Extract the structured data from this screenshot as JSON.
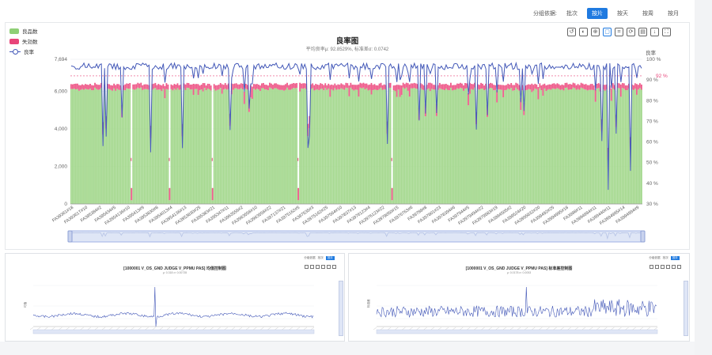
{
  "group_bar": {
    "label": "分组依据:",
    "options": [
      "批次",
      "按片",
      "按天",
      "按周",
      "按月"
    ],
    "active_index": 1
  },
  "main_chart": {
    "title": "良率图",
    "subtitle": "平均良率μ: 92.8529%, 标准差σ: 0.0742",
    "legend": [
      {
        "name": "良品数",
        "color": "#8fcf76"
      },
      {
        "name": "失効数",
        "color": "#e8457a"
      },
      {
        "name": "良率",
        "color": "#4358b8"
      }
    ],
    "right_axis_name": "良率",
    "avg_label": "92 %",
    "toolbox_icons": [
      "restore-icon",
      "palette-icon",
      "zoom-icon",
      "select-rect-icon",
      "select-lasso-icon",
      "refresh-icon",
      "data-view-icon",
      "download-icon",
      "fullscreen-icon"
    ]
  },
  "chart_data": [
    {
      "type": "bar",
      "title": "良率图",
      "subtitle": "平均良率μ: 92.8529%, 标准差σ: 0.0742",
      "ylim_left": [
        0,
        7694
      ],
      "left_ticks": [
        "0",
        "2,000",
        "4,000",
        "6,000",
        "7,694"
      ],
      "ylim_right": [
        30,
        100
      ],
      "right_ticks": [
        "30 %",
        "40 %",
        "50 %",
        "60 %",
        "70 %",
        "80 %",
        "90 %",
        "100 %"
      ],
      "x_tick_labels": [
        "FA39361#18",
        "FA39361T#10",
        "FA395384#2",
        "FA395434#5",
        "FA3954136#10",
        "FA395413#9",
        "FA3953830#8",
        "FA3954013#4",
        "FA3954136#13",
        "FA3953830#25",
        "FA395383#21",
        "FA395347#11",
        "FA3963556#2",
        "FA3963556#10",
        "FA3963556#22",
        "FA397137#21",
        "FA3975162#5",
        "FA397535#3",
        "FA3975162#25",
        "FA397564#10",
        "FA397837#13",
        "FA3976123#4",
        "FA3976123#22",
        "FA3979050#15",
        "FA3976763#6",
        "FA39789#8",
        "FA397801#23",
        "FA3978394#6",
        "FA397944#5",
        "FA3979494#22",
        "FA3979583#19",
        "FA3994505#2",
        "FA399524#20",
        "FA3995832#20",
        "FA399492#25",
        "FA3994995#18",
        "FA3998#11",
        "FA3994994#11",
        "FA399440#11",
        "FA3994995#14",
        "FA3994994#9"
      ],
      "series": [
        {
          "name": "良品数",
          "kind": "bar",
          "typical": 5950,
          "total": 6350
        },
        {
          "name": "失効数",
          "kind": "bar",
          "typical": 400
        },
        {
          "name": "良率",
          "kind": "line",
          "mean_percent": 92.85,
          "min_percent": 33,
          "max_percent": 98
        }
      ],
      "avg_line_percent": 92,
      "legend_position": "top-left"
    },
    {
      "type": "line",
      "title": "[1000001 V_OS_GND JUDGE V_PPMU PAS] 均值控制图",
      "subtitle": "μ: 0.318  σ: 0.00735",
      "ylabel": "均值",
      "series": [
        {
          "name": "",
          "values": []
        }
      ]
    },
    {
      "type": "line",
      "title": "[1000001 V_OS_GND JUDGE V_PPMU PAS] 标准差控制图",
      "subtitle": "μ: 0.0178  σ: 0.0053",
      "ylabel": "标准差",
      "series": [
        {
          "name": "",
          "values": []
        }
      ]
    }
  ],
  "sub_left": {
    "title": "[1000001 V_OS_GND JUDGE V_PPMU PAS] 均值控制图",
    "subtitle": "μ: 0.318  σ: 0.00735",
    "ylabel": "均值",
    "group_label": "分组依据",
    "group_opts": [
      "批次",
      "按片"
    ]
  },
  "sub_right": {
    "title": "[1000001 V_OS_GND JUDGE V_PPMU PAS] 标准差控制图",
    "subtitle": "μ: 0.0178  σ: 0.0053",
    "ylabel": "标准差",
    "group_label": "分组依据",
    "group_opts": [
      "批次",
      "按片"
    ]
  }
}
